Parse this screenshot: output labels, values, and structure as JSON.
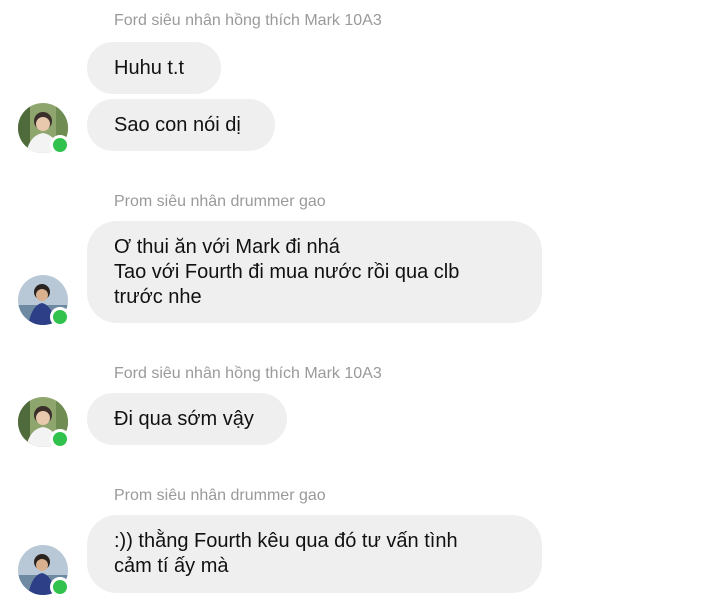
{
  "colors": {
    "bubble": "#efefef",
    "sender_name": "#9a9a9a",
    "message_text": "#111111",
    "online_indicator": "#31c24d"
  },
  "messages": [
    {
      "sender": "Ford siêu nhân hồng thích Mark 10A3",
      "avatar": "ford-avatar",
      "online": true,
      "bubbles": [
        {
          "lines": [
            "Huhu t.t"
          ]
        },
        {
          "lines": [
            "Sao con nói dị"
          ]
        }
      ]
    },
    {
      "sender": "Prom siêu nhân drummer gao",
      "avatar": "prom-avatar",
      "online": true,
      "bubbles": [
        {
          "lines": [
            "Ơ thui ăn với Mark đi nhá",
            "Tao với Fourth đi mua nước rồi qua clb",
            "trước nhe"
          ]
        }
      ]
    },
    {
      "sender": "Ford siêu nhân hồng thích Mark 10A3",
      "avatar": "ford-avatar",
      "online": true,
      "bubbles": [
        {
          "lines": [
            "Đi qua sớm vậy"
          ]
        }
      ]
    },
    {
      "sender": "Prom siêu nhân drummer gao",
      "avatar": "prom-avatar",
      "online": true,
      "bubbles": [
        {
          "lines": [
            ":)) thằng Fourth kêu qua đó tư vấn tình",
            "cảm tí ấy mà"
          ]
        }
      ]
    }
  ]
}
